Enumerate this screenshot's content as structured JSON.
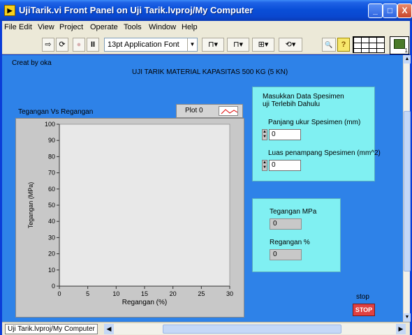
{
  "window": {
    "title": "UjiTarik.vi Front Panel on Uji Tarik.lvproj/My Computer",
    "icon": "labview-icon",
    "buttons": {
      "minimize": "_",
      "maximize": "□",
      "close": "X"
    }
  },
  "menu": [
    "File",
    "Edit",
    "View",
    "Project",
    "Operate",
    "Tools",
    "Window",
    "Help"
  ],
  "toolbar": {
    "run": "⇨",
    "run_continuously": "⟳",
    "abort": "●",
    "pause": "II",
    "font": "13pt Application Font",
    "align": "⊓▾",
    "distribute": "⊓▾",
    "resize": "⊞▾",
    "reorder": "⟲▾",
    "search": "🔍",
    "help": "?",
    "instance_count": "1"
  },
  "panel": {
    "author": "Creat by oka",
    "heading": "UJI TARIK MATERIAL KAPASITAS 500 KG (5 KN)",
    "graph": {
      "title": "Tegangan Vs Regangan",
      "legend_label": "Plot 0"
    },
    "input_group": {
      "heading_line1": "Masukkan Data Spesimen",
      "heading_line2": "uji Terlebih Dahulu",
      "length_label": "Panjang ukur Spesimen (mm)",
      "length_value": "0",
      "area_label": "Luas penampang Spesimen (mm^2)",
      "area_value": "0"
    },
    "output_group": {
      "stress_label": "Tegangan MPa",
      "stress_value": "0",
      "strain_label": "Regangan %",
      "strain_value": "0"
    },
    "stop": {
      "label": "stop",
      "button_text": "STOP"
    }
  },
  "status": {
    "path": "Uji Tarik.lvproj/My Computer"
  },
  "colors": {
    "panel_bg": "#2e82e8",
    "box_bg": "#80f0f2",
    "plot_bg": "#e8e8e8",
    "stop_red": "#e04040"
  },
  "chart_data": {
    "type": "line",
    "title": "Tegangan Vs Regangan",
    "xlabel": "Regangan (%)",
    "ylabel": "Tegangan (MPa)",
    "xlim": [
      0,
      30
    ],
    "ylim": [
      0,
      100
    ],
    "xticks": [
      0,
      5,
      10,
      15,
      20,
      25,
      30
    ],
    "yticks": [
      0,
      10,
      20,
      30,
      40,
      50,
      60,
      70,
      80,
      90,
      100
    ],
    "series": [
      {
        "name": "Plot 0",
        "x": [],
        "y": []
      }
    ],
    "legend": "top-right",
    "grid": false
  }
}
